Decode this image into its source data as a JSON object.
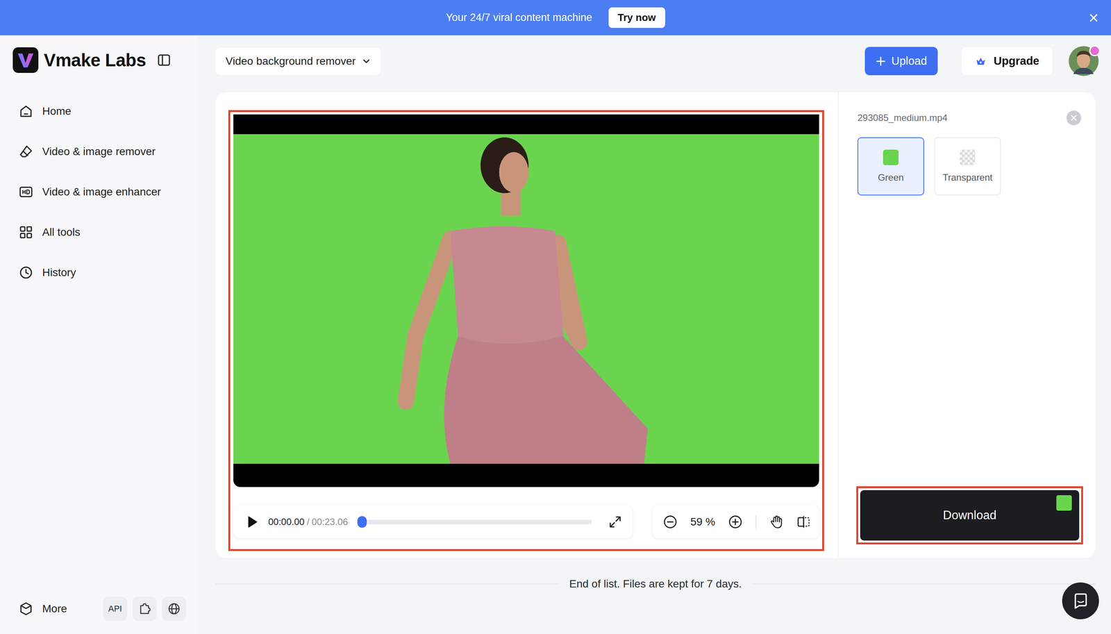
{
  "banner": {
    "text": "Your 24/7 viral content machine",
    "button": "Try now",
    "close": "×"
  },
  "sidebar": {
    "brand": "Vmake Labs",
    "items": [
      {
        "label": "Home",
        "selected": false
      },
      {
        "label": "Video & image remover",
        "selected": false
      },
      {
        "label": "Video & image enhancer",
        "selected": false
      },
      {
        "label": "All tools",
        "selected": false
      },
      {
        "label": "History",
        "selected": false
      }
    ],
    "footer": {
      "more": "More",
      "api": "API"
    }
  },
  "toolbar": {
    "tool_select": "Video background remover",
    "upload": "Upload",
    "upgrade": "Upgrade"
  },
  "player": {
    "current_time": "00:00.00",
    "separator": "/",
    "duration": "00:23.06",
    "level": 0,
    "zoom": "59 %"
  },
  "panel": {
    "filename": "293085_medium.mp4",
    "backgrounds": [
      {
        "label": "Green",
        "selected": true,
        "kind": "color",
        "color": "#6bd44f"
      },
      {
        "label": "Transparent",
        "selected": false,
        "kind": "checker"
      }
    ],
    "download": "Download"
  },
  "footer": {
    "note": "End of list. Files are kept for 7 days."
  }
}
